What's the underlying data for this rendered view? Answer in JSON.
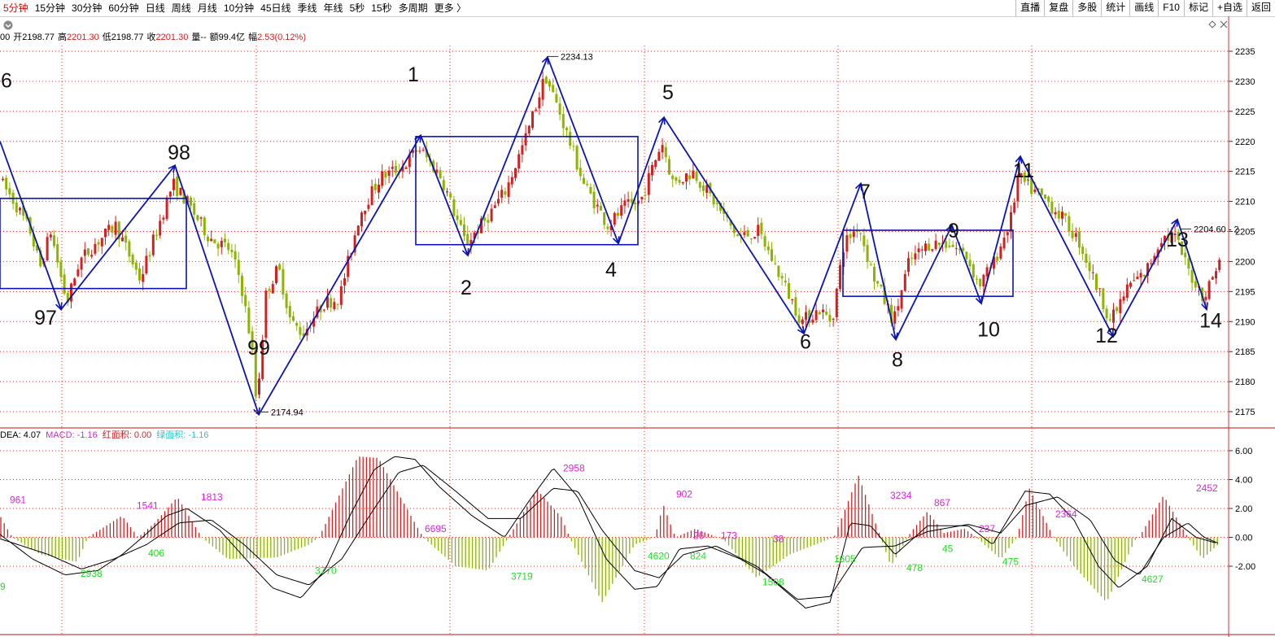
{
  "toolbar": {
    "periods": [
      "5分钟",
      "15分钟",
      "30分钟",
      "60分钟",
      "日线",
      "周线",
      "月线",
      "10分钟",
      "45日线",
      "季线",
      "年线",
      "5秒",
      "15秒",
      "多周期",
      "更多 〉"
    ],
    "active_period": "5分钟",
    "tools": [
      "直播",
      "复盘",
      "多股",
      "统计",
      "画线",
      "F10",
      "标记",
      "+自选",
      "返回"
    ]
  },
  "quote_bar": {
    "prefix": "00",
    "open_label": "开",
    "open": "2198.77",
    "high_label": "高",
    "high": "2201.30",
    "low_label": "低",
    "low": "2198.77",
    "close_label": "收",
    "close": "2201.30",
    "volume_label": "量--",
    "amount_label": "额99.4亿",
    "change_label": "幅",
    "change": "2.53(0.12%)"
  },
  "macd_bar": {
    "dea_label": "DEA: ",
    "dea": "4.07",
    "macd_label": "MACD: ",
    "macd": "-1.16",
    "red_label": "红面积: ",
    "red": "0.00",
    "green_label": "绿面积: ",
    "green": "-1.16"
  },
  "colors": {
    "up": "#d42020",
    "down": "#8cb400",
    "wave": "#0a14b4",
    "grid": "#d43030",
    "macd_label": "#e020e0",
    "green_num": "#22dd22"
  },
  "chart_data": [
    {
      "type": "candlestick",
      "ylim": [
        2172,
        2238
      ],
      "y_ticks": [
        2175,
        2180,
        2185,
        2190,
        2195,
        2200,
        2205,
        2210,
        2215,
        2220,
        2225,
        2230,
        2235
      ],
      "x_range": [
        0,
        1505
      ],
      "price_labels": [
        {
          "text": "2234.13",
          "x": 672,
          "y": 2234.13
        },
        {
          "text": "2174.94",
          "x": 316,
          "y": 2174.94
        },
        {
          "text": "2204.60 - 2",
          "x": 1450,
          "y": 2205.4
        }
      ],
      "wave_path": [
        [
          0,
          2220
        ],
        [
          75,
          2192
        ],
        [
          215,
          2216
        ],
        [
          318,
          2174.5
        ],
        [
          517,
          2221
        ],
        [
          575,
          2201
        ],
        [
          673,
          2234
        ],
        [
          760,
          2203
        ],
        [
          816,
          2224
        ],
        [
          988,
          2188
        ],
        [
          1058,
          2213
        ],
        [
          1101,
          2187
        ],
        [
          1170,
          2206
        ],
        [
          1206,
          2193
        ],
        [
          1254,
          2217.5
        ],
        [
          1368,
          2187.5
        ],
        [
          1447,
          2207
        ],
        [
          1483,
          2192
        ]
      ],
      "wave_labels": [
        {
          "text": "6",
          "x": 8,
          "y": 2229
        },
        {
          "text": "97",
          "x": 56,
          "y": 2189.5
        },
        {
          "text": "98",
          "x": 220,
          "y": 2217
        },
        {
          "text": "99",
          "x": 318,
          "y": 2184.5
        },
        {
          "text": "1",
          "x": 508,
          "y": 2230
        },
        {
          "text": "2",
          "x": 573,
          "y": 2194.5
        },
        {
          "text": "4",
          "x": 751,
          "y": 2197.5
        },
        {
          "text": "5",
          "x": 821,
          "y": 2227
        },
        {
          "text": "6",
          "x": 990,
          "y": 2185.5
        },
        {
          "text": "7",
          "x": 1063,
          "y": 2210.5
        },
        {
          "text": "8",
          "x": 1103,
          "y": 2182.5
        },
        {
          "text": "9",
          "x": 1172,
          "y": 2204
        },
        {
          "text": "10",
          "x": 1215,
          "y": 2187.5
        },
        {
          "text": "11",
          "x": 1258,
          "y": 2214
        },
        {
          "text": "12",
          "x": 1360,
          "y": 2186.5
        },
        {
          "text": "13",
          "x": 1447,
          "y": 2202.5
        },
        {
          "text": "14",
          "x": 1488,
          "y": 2189
        }
      ],
      "boxes": [
        {
          "x1": 0,
          "x2": 229,
          "y_top": 2210.5,
          "y_bot": 2195.5
        },
        {
          "x1": 511,
          "x2": 784,
          "y_top": 2220.8,
          "y_bot": 2202.8
        },
        {
          "x1": 1036,
          "x2": 1245,
          "y_top": 2205.2,
          "y_bot": 2194.2
        }
      ],
      "anchors": [
        [
          0,
          2214
        ],
        [
          20,
          2210
        ],
        [
          40,
          2205
        ],
        [
          52,
          2199
        ],
        [
          65,
          2205
        ],
        [
          85,
          2193
        ],
        [
          100,
          2200
        ],
        [
          120,
          2203
        ],
        [
          145,
          2206
        ],
        [
          175,
          2197
        ],
        [
          200,
          2207
        ],
        [
          215,
          2213
        ],
        [
          232,
          2210
        ],
        [
          260,
          2204
        ],
        [
          285,
          2202
        ],
        [
          298,
          2197
        ],
        [
          312,
          2186
        ],
        [
          318,
          2176
        ],
        [
          330,
          2195
        ],
        [
          345,
          2199
        ],
        [
          360,
          2190
        ],
        [
          375,
          2188
        ],
        [
          400,
          2193
        ],
        [
          420,
          2194
        ],
        [
          445,
          2208
        ],
        [
          470,
          2214
        ],
        [
          500,
          2216
        ],
        [
          517,
          2219
        ],
        [
          545,
          2214
        ],
        [
          575,
          2203
        ],
        [
          600,
          2207
        ],
        [
          625,
          2212
        ],
        [
          650,
          2221
        ],
        [
          673,
          2231
        ],
        [
          690,
          2225
        ],
        [
          720,
          2213
        ],
        [
          750,
          2206
        ],
        [
          770,
          2209
        ],
        [
          790,
          2210
        ],
        [
          816,
          2220
        ],
        [
          830,
          2213
        ],
        [
          855,
          2215
        ],
        [
          880,
          2210
        ],
        [
          910,
          2204
        ],
        [
          935,
          2205
        ],
        [
          960,
          2198
        ],
        [
          988,
          2190
        ],
        [
          1010,
          2192
        ],
        [
          1025,
          2190
        ],
        [
          1040,
          2203
        ],
        [
          1058,
          2206
        ],
        [
          1075,
          2198
        ],
        [
          1101,
          2190
        ],
        [
          1120,
          2200
        ],
        [
          1145,
          2203
        ],
        [
          1170,
          2203
        ],
        [
          1190,
          2201
        ],
        [
          1206,
          2196
        ],
        [
          1225,
          2200
        ],
        [
          1245,
          2207
        ],
        [
          1254,
          2214
        ],
        [
          1270,
          2212
        ],
        [
          1290,
          2210
        ],
        [
          1310,
          2207
        ],
        [
          1330,
          2203
        ],
        [
          1350,
          2196
        ],
        [
          1368,
          2190
        ],
        [
          1390,
          2196
        ],
        [
          1410,
          2198
        ],
        [
          1430,
          2204
        ],
        [
          1447,
          2204
        ],
        [
          1465,
          2198
        ],
        [
          1483,
          2194
        ],
        [
          1500,
          2200
        ]
      ]
    },
    {
      "type": "macd",
      "ylim": [
        -5.5,
        7.3
      ],
      "y_ticks": [
        "6.00",
        "4.00",
        "2.00",
        "0.00",
        "-2.00"
      ],
      "y_tick_values": [
        6,
        4,
        2,
        0,
        -2
      ],
      "hist_anchors": [
        [
          0,
          1.5
        ],
        [
          15,
          0
        ],
        [
          50,
          -1.2
        ],
        [
          95,
          -1.7
        ],
        [
          108,
          0
        ],
        [
          150,
          1.5
        ],
        [
          170,
          0
        ],
        [
          190,
          1
        ],
        [
          218,
          2.8
        ],
        [
          248,
          0
        ],
        [
          280,
          -1.5
        ],
        [
          340,
          -1.4
        ],
        [
          380,
          -0.5
        ],
        [
          392,
          0
        ],
        [
          440,
          5.6
        ],
        [
          465,
          5.5
        ],
        [
          520,
          0
        ],
        [
          560,
          -2
        ],
        [
          600,
          -2.3
        ],
        [
          625,
          0
        ],
        [
          660,
          3.3
        ],
        [
          690,
          1.4
        ],
        [
          700,
          0
        ],
        [
          740,
          -4.5
        ],
        [
          780,
          -0.5
        ],
        [
          805,
          0
        ],
        [
          815,
          2.3
        ],
        [
          830,
          0
        ],
        [
          855,
          0.6
        ],
        [
          890,
          -0.2
        ],
        [
          930,
          -2.8
        ],
        [
          970,
          -1.2
        ],
        [
          1025,
          0
        ],
        [
          1055,
          4.3
        ],
        [
          1095,
          -2
        ],
        [
          1120,
          0.4
        ],
        [
          1140,
          1.8
        ],
        [
          1160,
          0.3
        ],
        [
          1185,
          0.6
        ],
        [
          1200,
          0
        ],
        [
          1230,
          -1.5
        ],
        [
          1250,
          0
        ],
        [
          1265,
          3.4
        ],
        [
          1295,
          0
        ],
        [
          1320,
          -2
        ],
        [
          1360,
          -4.5
        ],
        [
          1395,
          -0.2
        ],
        [
          1400,
          0
        ],
        [
          1430,
          2.9
        ],
        [
          1460,
          0
        ],
        [
          1478,
          -1.5
        ],
        [
          1497,
          -0.5
        ]
      ],
      "dif_line": [
        [
          0,
          0.2
        ],
        [
          40,
          -1.5
        ],
        [
          80,
          -2.6
        ],
        [
          120,
          -2.3
        ],
        [
          150,
          -1.2
        ],
        [
          175,
          0
        ],
        [
          205,
          1.5
        ],
        [
          230,
          2
        ],
        [
          270,
          0.5
        ],
        [
          310,
          -2
        ],
        [
          335,
          -3.5
        ],
        [
          370,
          -4.2
        ],
        [
          400,
          -2.2
        ],
        [
          430,
          1.5
        ],
        [
          460,
          4.7
        ],
        [
          485,
          5.6
        ],
        [
          510,
          5.4
        ],
        [
          540,
          3.5
        ],
        [
          580,
          1.5
        ],
        [
          620,
          0
        ],
        [
          650,
          2.5
        ],
        [
          680,
          4.8
        ],
        [
          710,
          2.8
        ],
        [
          745,
          -1.5
        ],
        [
          780,
          -3.6
        ],
        [
          808,
          -3.4
        ],
        [
          835,
          -0.8
        ],
        [
          870,
          -0.6
        ],
        [
          910,
          -1.5
        ],
        [
          940,
          -2.5
        ],
        [
          990,
          -4.9
        ],
        [
          1020,
          -4.5
        ],
        [
          1045,
          1
        ],
        [
          1070,
          0.8
        ],
        [
          1100,
          -1.2
        ],
        [
          1140,
          0.8
        ],
        [
          1190,
          0.8
        ],
        [
          1220,
          -0.5
        ],
        [
          1260,
          3.2
        ],
        [
          1290,
          3
        ],
        [
          1320,
          1.2
        ],
        [
          1350,
          -2
        ],
        [
          1375,
          -3.5
        ],
        [
          1410,
          -2
        ],
        [
          1440,
          1.3
        ],
        [
          1470,
          0
        ],
        [
          1495,
          -0.4
        ]
      ],
      "dea_line": [
        [
          0,
          -0.1
        ],
        [
          60,
          -1.2
        ],
        [
          100,
          -2.2
        ],
        [
          140,
          -1.5
        ],
        [
          180,
          -0.5
        ],
        [
          220,
          1
        ],
        [
          260,
          1.2
        ],
        [
          300,
          -0.5
        ],
        [
          340,
          -2.6
        ],
        [
          380,
          -3.3
        ],
        [
          420,
          -1.5
        ],
        [
          460,
          2
        ],
        [
          490,
          4.5
        ],
        [
          520,
          5
        ],
        [
          560,
          3.2
        ],
        [
          600,
          1.3
        ],
        [
          640,
          1.3
        ],
        [
          680,
          3.4
        ],
        [
          710,
          3.2
        ],
        [
          740,
          0.5
        ],
        [
          780,
          -2.3
        ],
        [
          810,
          -2.8
        ],
        [
          840,
          -1.2
        ],
        [
          880,
          -0.6
        ],
        [
          930,
          -2
        ],
        [
          980,
          -4.3
        ],
        [
          1020,
          -4.1
        ],
        [
          1060,
          -0.7
        ],
        [
          1100,
          -0.6
        ],
        [
          1140,
          0.4
        ],
        [
          1190,
          0.9
        ],
        [
          1230,
          0.3
        ],
        [
          1260,
          2.2
        ],
        [
          1300,
          2.8
        ],
        [
          1340,
          1.2
        ],
        [
          1370,
          -1.6
        ],
        [
          1400,
          -2.6
        ],
        [
          1430,
          0
        ],
        [
          1460,
          1
        ],
        [
          1480,
          0
        ],
        [
          1497,
          -0.4
        ]
      ],
      "magenta_numbers": [
        {
          "text": "961",
          "x": 12,
          "y": 2.6
        },
        {
          "text": "1541",
          "x": 168,
          "y": 2.2
        },
        {
          "text": "1813",
          "x": 247,
          "y": 2.8
        },
        {
          "text": "6695",
          "x": 522,
          "y": 0.6
        },
        {
          "text": "2958",
          "x": 692,
          "y": 4.8
        },
        {
          "text": "902",
          "x": 831,
          "y": 3
        },
        {
          "text": "26",
          "x": 852,
          "y": 0.1
        },
        {
          "text": "173",
          "x": 886,
          "y": 0.1
        },
        {
          "text": "38",
          "x": 950,
          "y": -0.1
        },
        {
          "text": "3234",
          "x": 1094,
          "y": 2.9
        },
        {
          "text": "867",
          "x": 1148,
          "y": 2.4
        },
        {
          "text": "237",
          "x": 1203,
          "y": 0.6
        },
        {
          "text": "2364",
          "x": 1297,
          "y": 1.6
        },
        {
          "text": "2452",
          "x": 1470,
          "y": 3.4
        }
      ],
      "green_numbers": [
        {
          "text": "9",
          "x": 0,
          "y": -3.4
        },
        {
          "text": "2938",
          "x": 99,
          "y": -2.5
        },
        {
          "text": "406",
          "x": 182,
          "y": -1.1
        },
        {
          "text": "3770",
          "x": 387,
          "y": -2.3
        },
        {
          "text": "3719",
          "x": 628,
          "y": -2.7
        },
        {
          "text": "4620",
          "x": 796,
          "y": -1.3
        },
        {
          "text": "824",
          "x": 848,
          "y": -1.3
        },
        {
          "text": "1508",
          "x": 937,
          "y": -3.1
        },
        {
          "text": "1605",
          "x": 1025,
          "y": -1.5
        },
        {
          "text": "478",
          "x": 1114,
          "y": -2.1
        },
        {
          "text": "45",
          "x": 1158,
          "y": -0.8
        },
        {
          "text": "475",
          "x": 1232,
          "y": -1.7
        },
        {
          "text": "4627",
          "x": 1403,
          "y": -2.9
        }
      ]
    }
  ]
}
